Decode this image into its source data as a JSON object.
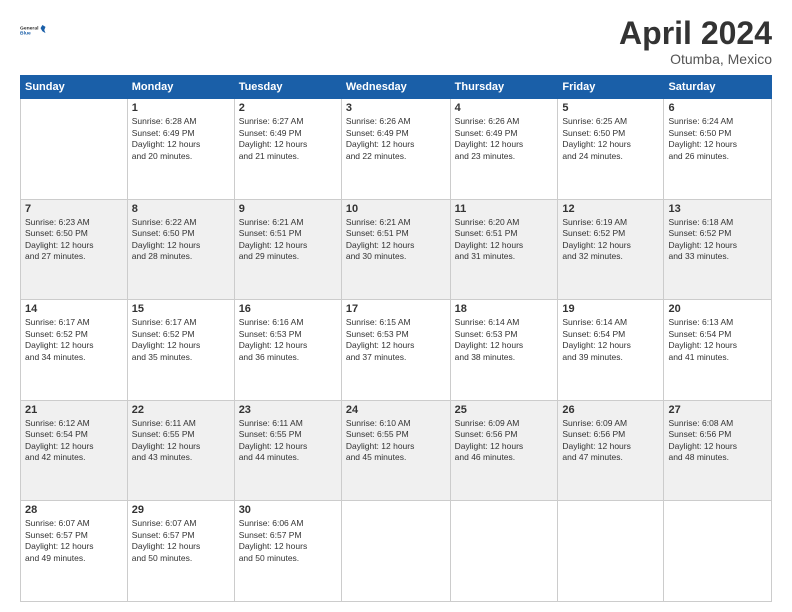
{
  "header": {
    "logo_line1": "General",
    "logo_line2": "Blue",
    "month": "April 2024",
    "location": "Otumba, Mexico"
  },
  "weekdays": [
    "Sunday",
    "Monday",
    "Tuesday",
    "Wednesday",
    "Thursday",
    "Friday",
    "Saturday"
  ],
  "weeks": [
    [
      {
        "day": "",
        "info": ""
      },
      {
        "day": "1",
        "info": "Sunrise: 6:28 AM\nSunset: 6:49 PM\nDaylight: 12 hours\nand 20 minutes."
      },
      {
        "day": "2",
        "info": "Sunrise: 6:27 AM\nSunset: 6:49 PM\nDaylight: 12 hours\nand 21 minutes."
      },
      {
        "day": "3",
        "info": "Sunrise: 6:26 AM\nSunset: 6:49 PM\nDaylight: 12 hours\nand 22 minutes."
      },
      {
        "day": "4",
        "info": "Sunrise: 6:26 AM\nSunset: 6:49 PM\nDaylight: 12 hours\nand 23 minutes."
      },
      {
        "day": "5",
        "info": "Sunrise: 6:25 AM\nSunset: 6:50 PM\nDaylight: 12 hours\nand 24 minutes."
      },
      {
        "day": "6",
        "info": "Sunrise: 6:24 AM\nSunset: 6:50 PM\nDaylight: 12 hours\nand 26 minutes."
      }
    ],
    [
      {
        "day": "7",
        "info": "Sunrise: 6:23 AM\nSunset: 6:50 PM\nDaylight: 12 hours\nand 27 minutes."
      },
      {
        "day": "8",
        "info": "Sunrise: 6:22 AM\nSunset: 6:50 PM\nDaylight: 12 hours\nand 28 minutes."
      },
      {
        "day": "9",
        "info": "Sunrise: 6:21 AM\nSunset: 6:51 PM\nDaylight: 12 hours\nand 29 minutes."
      },
      {
        "day": "10",
        "info": "Sunrise: 6:21 AM\nSunset: 6:51 PM\nDaylight: 12 hours\nand 30 minutes."
      },
      {
        "day": "11",
        "info": "Sunrise: 6:20 AM\nSunset: 6:51 PM\nDaylight: 12 hours\nand 31 minutes."
      },
      {
        "day": "12",
        "info": "Sunrise: 6:19 AM\nSunset: 6:52 PM\nDaylight: 12 hours\nand 32 minutes."
      },
      {
        "day": "13",
        "info": "Sunrise: 6:18 AM\nSunset: 6:52 PM\nDaylight: 12 hours\nand 33 minutes."
      }
    ],
    [
      {
        "day": "14",
        "info": "Sunrise: 6:17 AM\nSunset: 6:52 PM\nDaylight: 12 hours\nand 34 minutes."
      },
      {
        "day": "15",
        "info": "Sunrise: 6:17 AM\nSunset: 6:52 PM\nDaylight: 12 hours\nand 35 minutes."
      },
      {
        "day": "16",
        "info": "Sunrise: 6:16 AM\nSunset: 6:53 PM\nDaylight: 12 hours\nand 36 minutes."
      },
      {
        "day": "17",
        "info": "Sunrise: 6:15 AM\nSunset: 6:53 PM\nDaylight: 12 hours\nand 37 minutes."
      },
      {
        "day": "18",
        "info": "Sunrise: 6:14 AM\nSunset: 6:53 PM\nDaylight: 12 hours\nand 38 minutes."
      },
      {
        "day": "19",
        "info": "Sunrise: 6:14 AM\nSunset: 6:54 PM\nDaylight: 12 hours\nand 39 minutes."
      },
      {
        "day": "20",
        "info": "Sunrise: 6:13 AM\nSunset: 6:54 PM\nDaylight: 12 hours\nand 41 minutes."
      }
    ],
    [
      {
        "day": "21",
        "info": "Sunrise: 6:12 AM\nSunset: 6:54 PM\nDaylight: 12 hours\nand 42 minutes."
      },
      {
        "day": "22",
        "info": "Sunrise: 6:11 AM\nSunset: 6:55 PM\nDaylight: 12 hours\nand 43 minutes."
      },
      {
        "day": "23",
        "info": "Sunrise: 6:11 AM\nSunset: 6:55 PM\nDaylight: 12 hours\nand 44 minutes."
      },
      {
        "day": "24",
        "info": "Sunrise: 6:10 AM\nSunset: 6:55 PM\nDaylight: 12 hours\nand 45 minutes."
      },
      {
        "day": "25",
        "info": "Sunrise: 6:09 AM\nSunset: 6:56 PM\nDaylight: 12 hours\nand 46 minutes."
      },
      {
        "day": "26",
        "info": "Sunrise: 6:09 AM\nSunset: 6:56 PM\nDaylight: 12 hours\nand 47 minutes."
      },
      {
        "day": "27",
        "info": "Sunrise: 6:08 AM\nSunset: 6:56 PM\nDaylight: 12 hours\nand 48 minutes."
      }
    ],
    [
      {
        "day": "28",
        "info": "Sunrise: 6:07 AM\nSunset: 6:57 PM\nDaylight: 12 hours\nand 49 minutes."
      },
      {
        "day": "29",
        "info": "Sunrise: 6:07 AM\nSunset: 6:57 PM\nDaylight: 12 hours\nand 50 minutes."
      },
      {
        "day": "30",
        "info": "Sunrise: 6:06 AM\nSunset: 6:57 PM\nDaylight: 12 hours\nand 50 minutes."
      },
      {
        "day": "",
        "info": ""
      },
      {
        "day": "",
        "info": ""
      },
      {
        "day": "",
        "info": ""
      },
      {
        "day": "",
        "info": ""
      }
    ]
  ]
}
